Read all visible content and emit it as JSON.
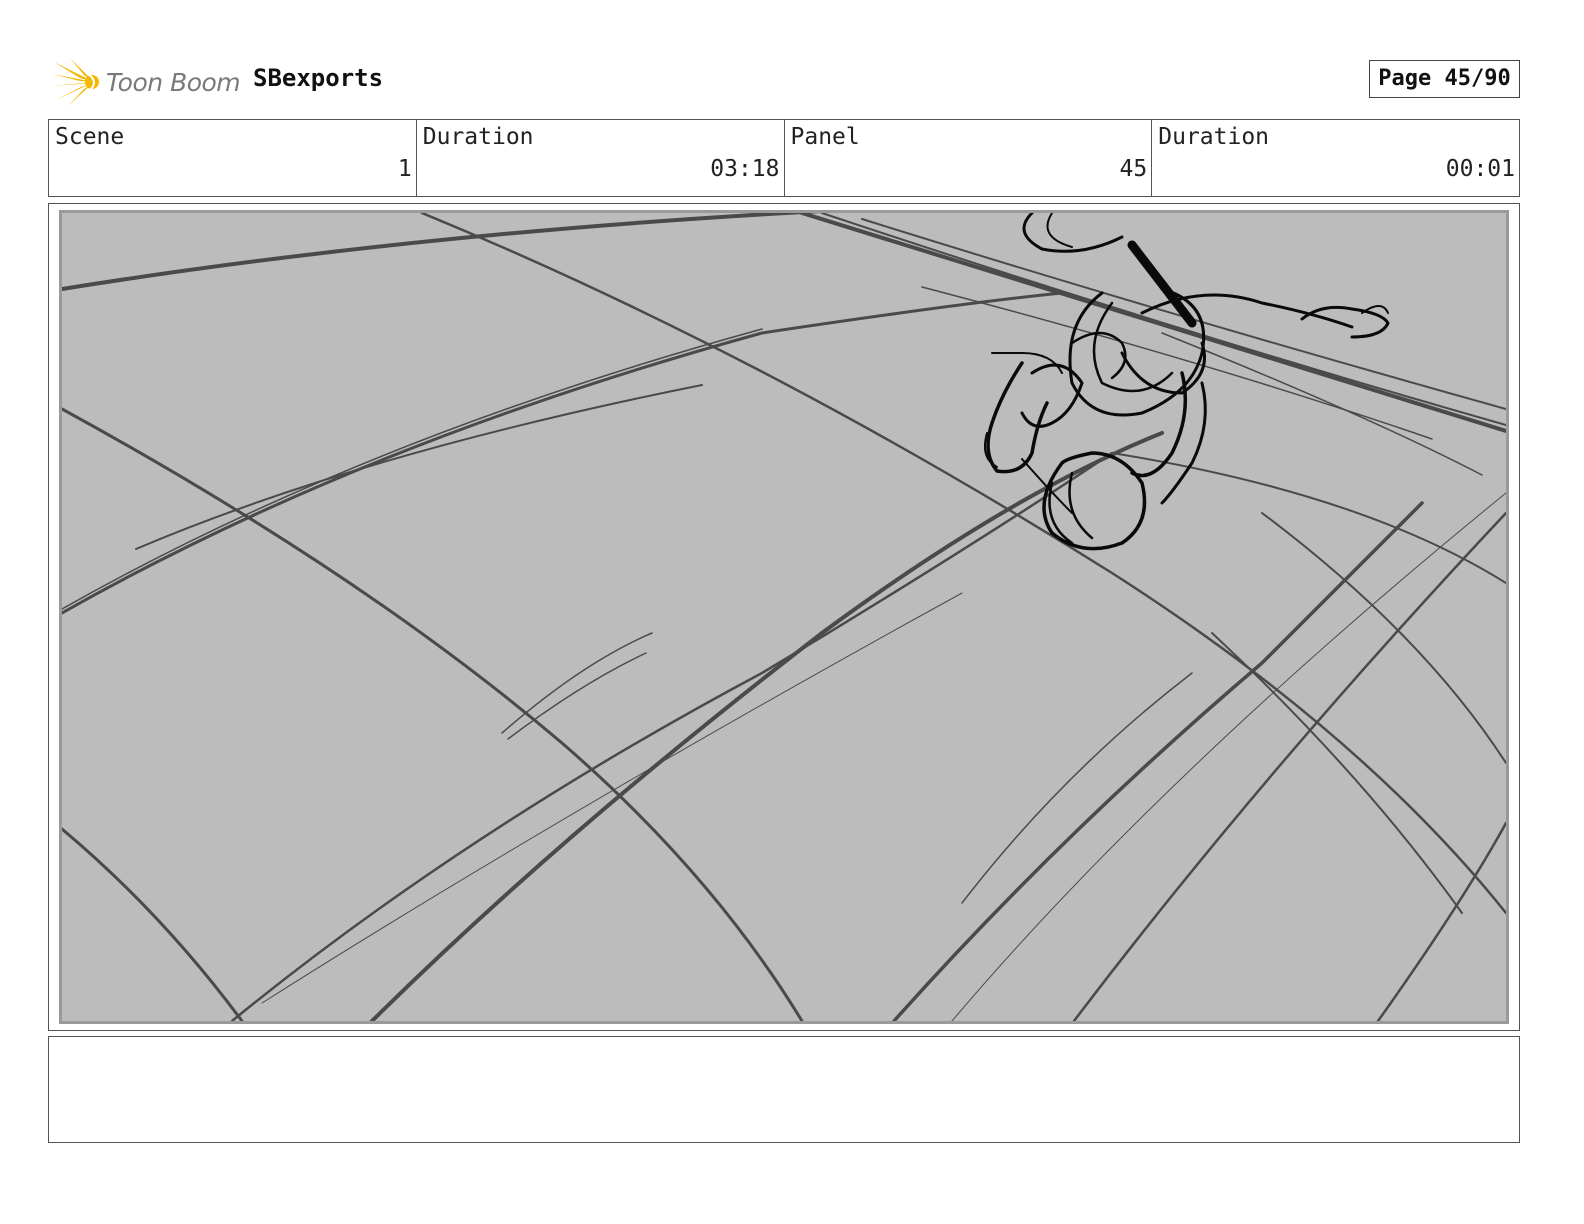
{
  "header": {
    "logo_text": "Toon Boom",
    "project_name": "SBexports",
    "page_label": "Page 45/90"
  },
  "info": {
    "scene_label": "Scene",
    "scene_value": "1",
    "scene_duration_label": "Duration",
    "scene_duration_value": "03:18",
    "panel_label": "Panel",
    "panel_value": "45",
    "panel_duration_label": "Duration",
    "panel_duration_value": "00:01"
  },
  "notes": {
    "text": ""
  },
  "colors": {
    "logo_star": "#f5b800",
    "logo_text": "#7a7a7a",
    "panel_background": "#bcbcbc",
    "sketch_lines": "#4a4a4a",
    "character_lines": "#0a0a0a"
  }
}
